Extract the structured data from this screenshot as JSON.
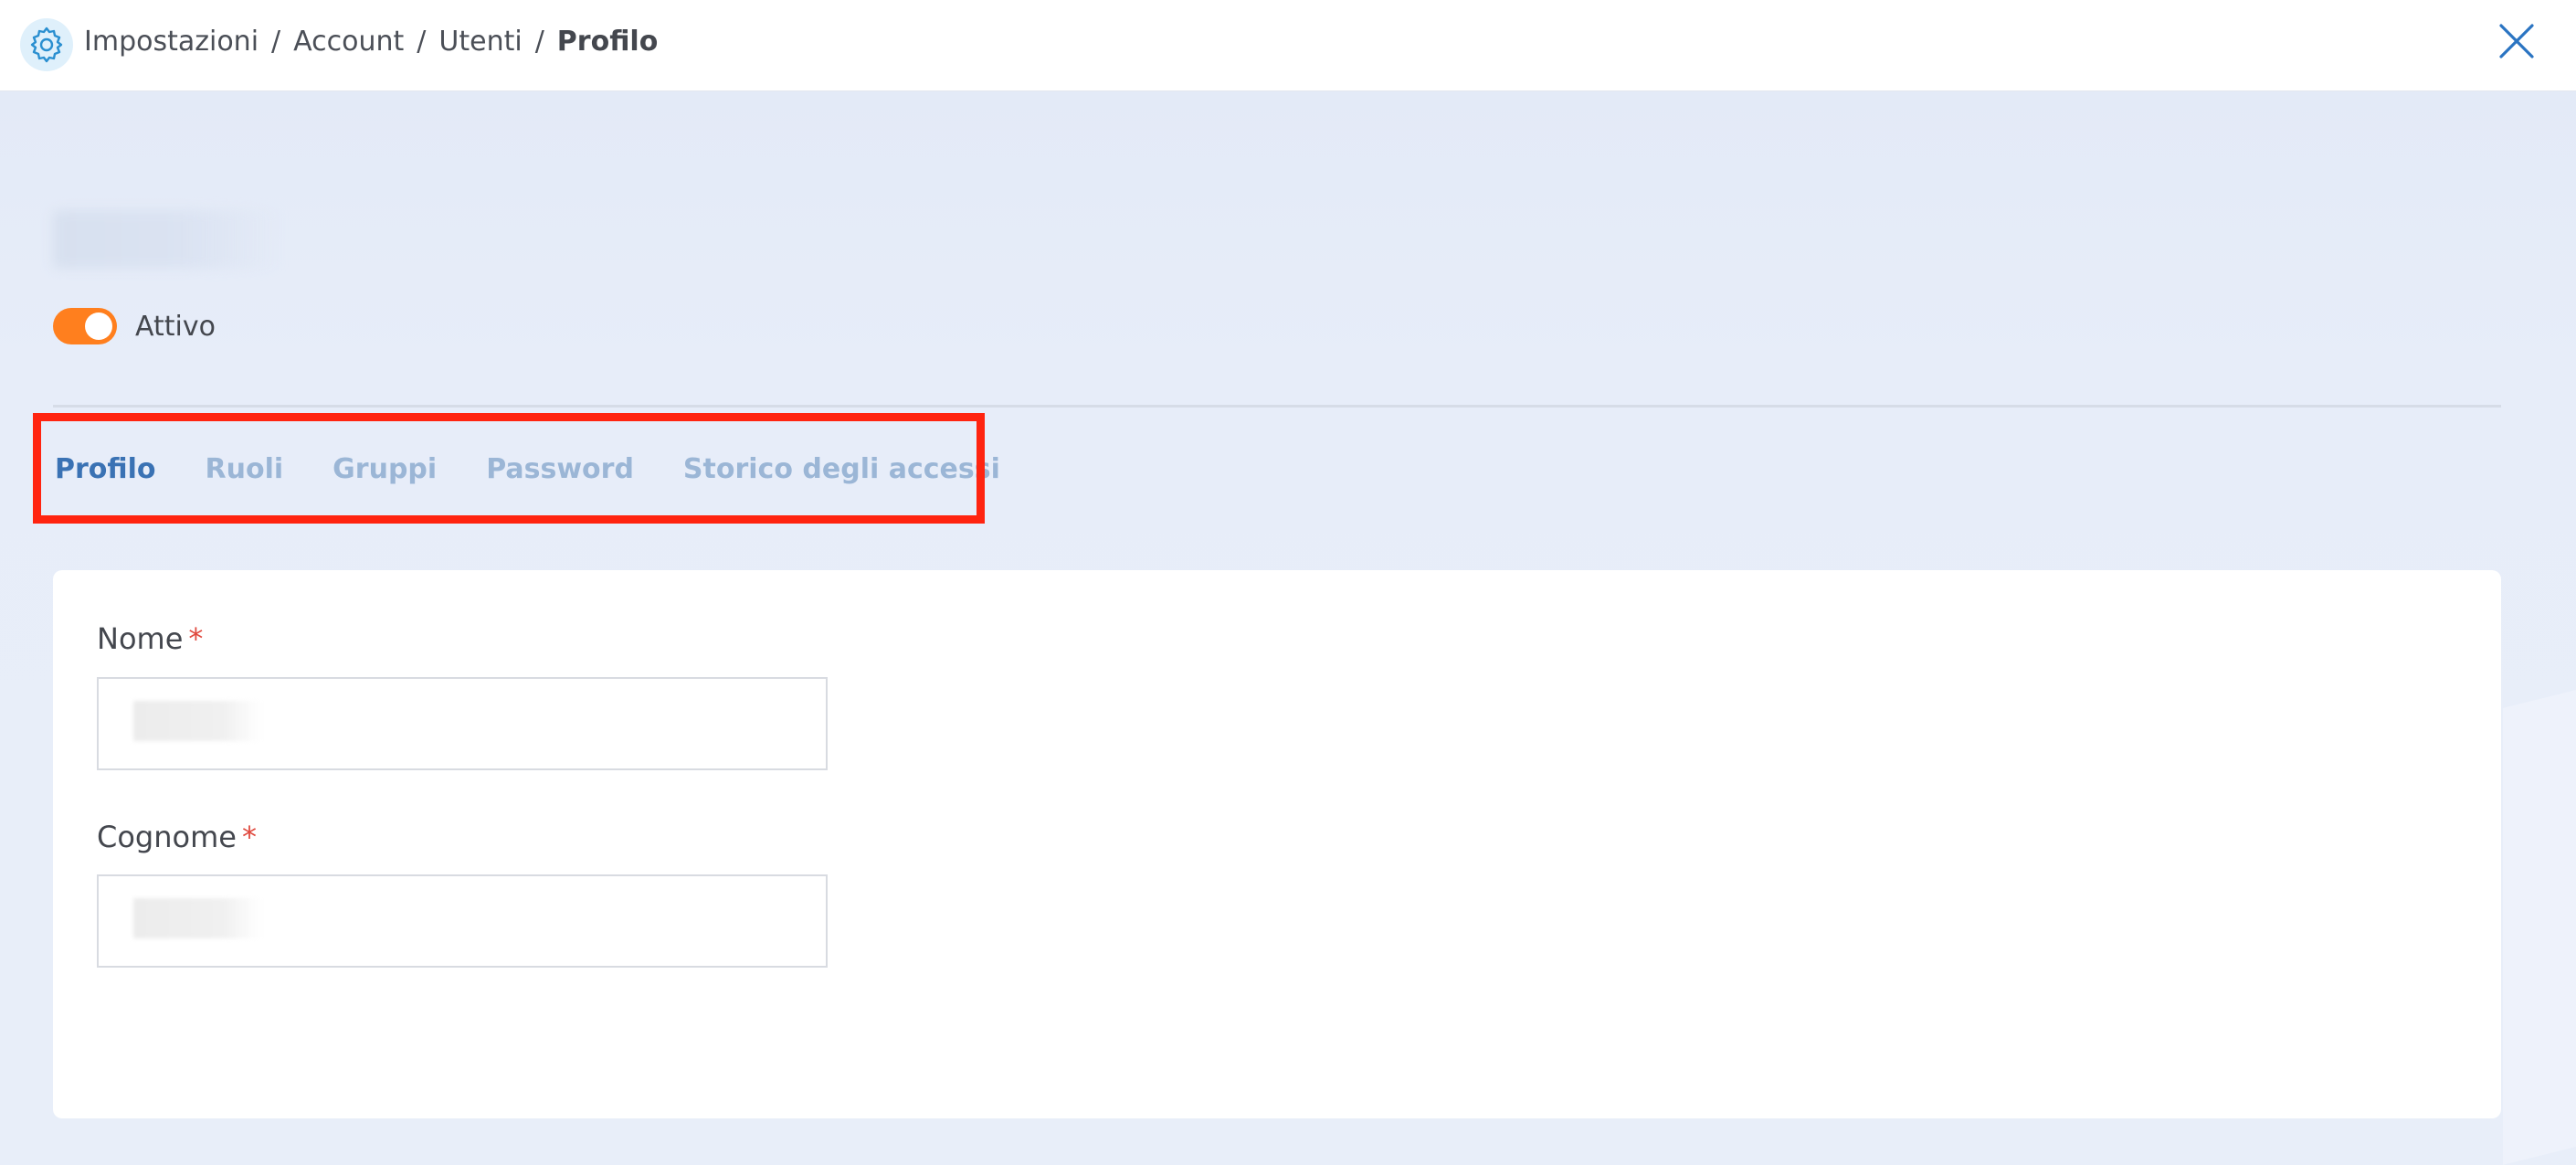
{
  "breadcrumb": {
    "items": [
      "Impostazioni",
      "Account",
      "Utenti"
    ],
    "separator": "/",
    "current": "Profilo"
  },
  "status": {
    "toggle_state": "on",
    "label": "Attivo"
  },
  "tabs": [
    {
      "label": "Profilo",
      "active": true
    },
    {
      "label": "Ruoli",
      "active": false
    },
    {
      "label": "Gruppi",
      "active": false
    },
    {
      "label": "Password",
      "active": false
    },
    {
      "label": "Storico degli accessi",
      "active": false
    }
  ],
  "form": {
    "nome": {
      "label": "Nome",
      "required_mark": "*"
    },
    "cognome": {
      "label": "Cognome",
      "required_mark": "*"
    }
  },
  "colors": {
    "accent": "#3a72b4",
    "tab_inactive": "#9bb6d6",
    "toggle_on": "#ff7f1e",
    "highlight": "#ff2410",
    "required": "#e04a3f"
  },
  "icons": {
    "app": "gear-icon",
    "close": "close-icon"
  }
}
